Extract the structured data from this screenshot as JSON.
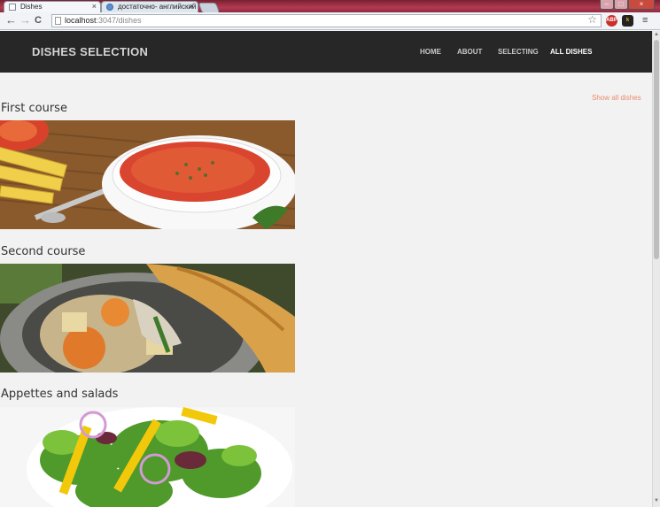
{
  "browser": {
    "tabs": [
      {
        "title": "Dishes",
        "close": "×"
      },
      {
        "title": "достаточно- английский",
        "close": "×"
      }
    ],
    "url_host": "localhost",
    "url_path": ":3047/dishes",
    "back_icon": "←",
    "forward_icon": "→",
    "reload_icon": "C",
    "star_icon": "☆",
    "menu_icon": "≡",
    "extensions": [
      {
        "label": "ABP",
        "color": "#c9302c"
      },
      {
        "label": "k",
        "color": "#f0a500"
      }
    ]
  },
  "site": {
    "brand": "DISHES SELECTION",
    "nav": [
      {
        "label": "HOME"
      },
      {
        "label": "ABOUT"
      },
      {
        "label": "SELECTING"
      },
      {
        "label": "ALL DISHES",
        "active": true
      }
    ],
    "show_all_link": "Show all dishes",
    "courses": [
      {
        "title": "First course",
        "image": "borscht-soup-photo"
      },
      {
        "title": "Second course",
        "image": "pot-roast-with-bread-photo"
      },
      {
        "title": "Appettes and salads",
        "image": "green-salad-photo"
      }
    ]
  },
  "colors": {
    "nav_bg": "#272727",
    "page_bg": "#f2f2f2",
    "link_accent": "#ec8a6c"
  }
}
